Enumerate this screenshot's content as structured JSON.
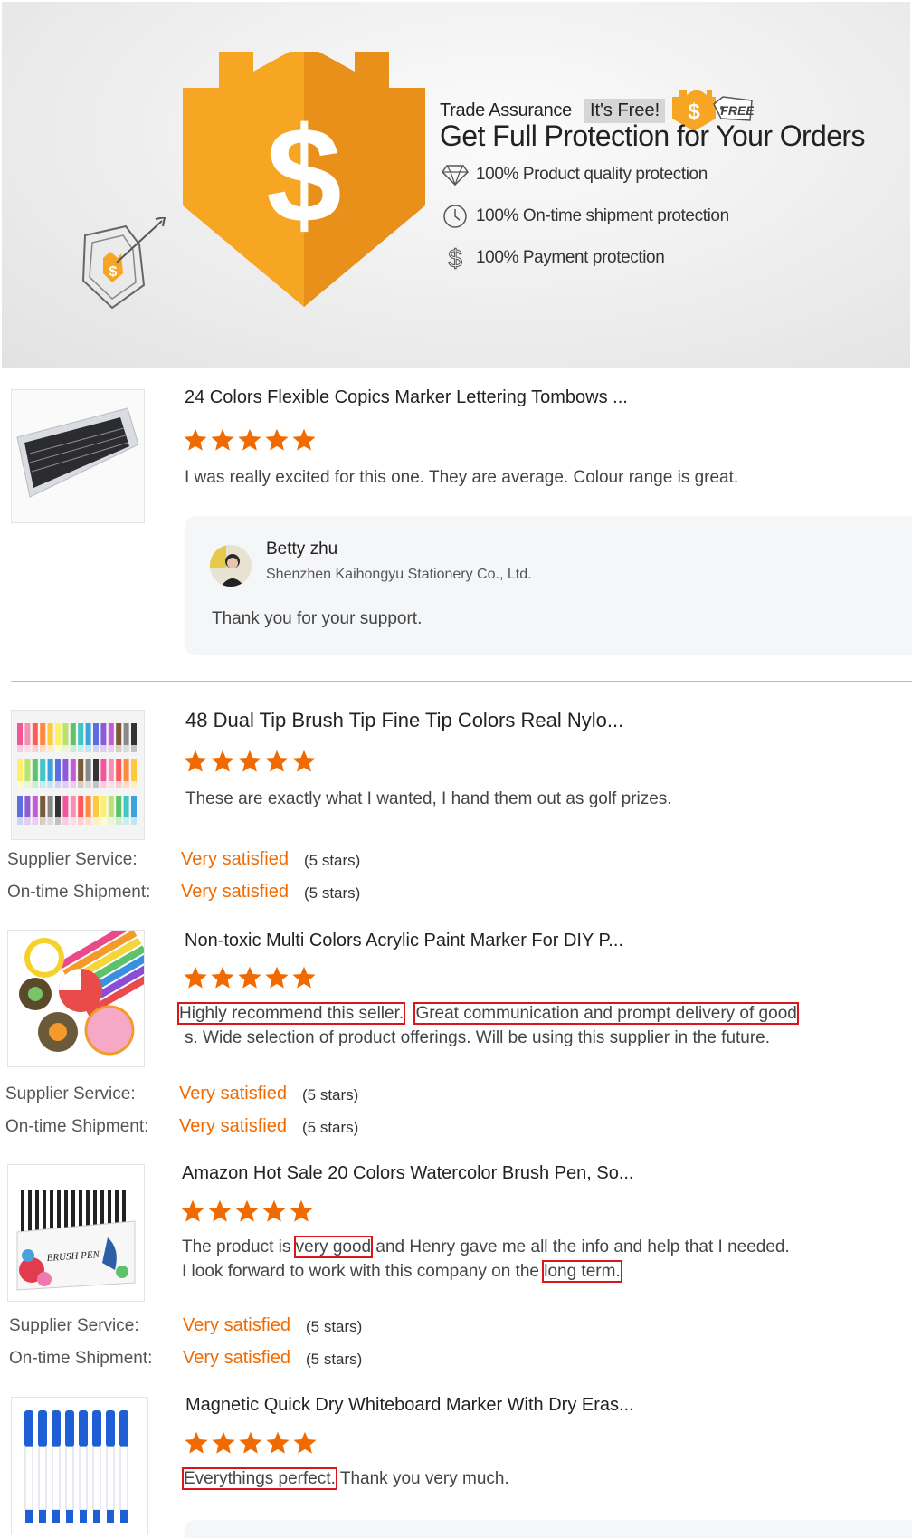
{
  "banner": {
    "trade_assurance": "Trade Assurance",
    "its_free": "It's Free!",
    "free_tag": "FREE",
    "headline": "Get Full Protection for Your Orders",
    "features": [
      {
        "icon": "diamond-icon",
        "text": "100% Product quality protection"
      },
      {
        "icon": "clock-icon",
        "text": "100% On-time shipment protection"
      },
      {
        "icon": "dollar-icon",
        "text": "100% Payment protection"
      }
    ],
    "colors": {
      "castle": "#f6a623",
      "castle_dark": "#e8901a"
    }
  },
  "rating_labels": {
    "supplier_service": "Supplier Service:",
    "ontime_shipment": "On-time Shipment:"
  },
  "reviews": [
    {
      "product": "24 Colors Flexible Copics Marker Lettering Tombows ...",
      "stars": 5,
      "text": "I was really excited for this one. They are average. Colour range is great.",
      "reply": {
        "name": "Betty zhu",
        "company": "Shenzhen Kaihongyu Stationery Co., Ltd.",
        "message": "Thank you for your support."
      }
    },
    {
      "product": "48 Dual Tip Brush Tip Fine Tip Colors Real Nylo...",
      "stars": 5,
      "text": "These are exactly what I wanted, I hand them out as golf prizes.",
      "supplier_service": "Very satisfied",
      "supplier_service_stars": "(5 stars)",
      "ontime_shipment": "Very satisfied",
      "ontime_shipment_stars": "(5 stars)"
    },
    {
      "product": "Non-toxic Multi Colors Acrylic Paint Marker For DIY P...",
      "stars": 5,
      "text_hl1": "Highly recommend this seller.",
      "text_hl2": "Great communication and prompt delivery of good",
      "text_line2": "s.  Wide selection of product offerings. Will be using this supplier in the future.",
      "supplier_service": "Very satisfied",
      "supplier_service_stars": "(5 stars)",
      "ontime_shipment": "Very satisfied",
      "ontime_shipment_stars": "(5 stars)"
    },
    {
      "product": "Amazon Hot Sale 20 Colors Watercolor Brush Pen, So...",
      "stars": 5,
      "line1_a": "The product is ",
      "line1_hl": "very good",
      "line1_b": " and Henry gave me all the info and help that I needed.",
      "line2_a": "I look forward to work with this company on the ",
      "line2_hl": "long term.",
      "thumb_text": "BRUSH PEN",
      "supplier_service": "Very satisfied",
      "supplier_service_stars": "(5 stars)",
      "ontime_shipment": "Very satisfied",
      "ontime_shipment_stars": "(5 stars)"
    },
    {
      "product": "Magnetic Quick Dry Whiteboard Marker With Dry Eras...",
      "stars": 5,
      "text_hl": "Everythings perfect.",
      "text_rest": " Thank you very much."
    }
  ],
  "star_color": "#f06a00"
}
